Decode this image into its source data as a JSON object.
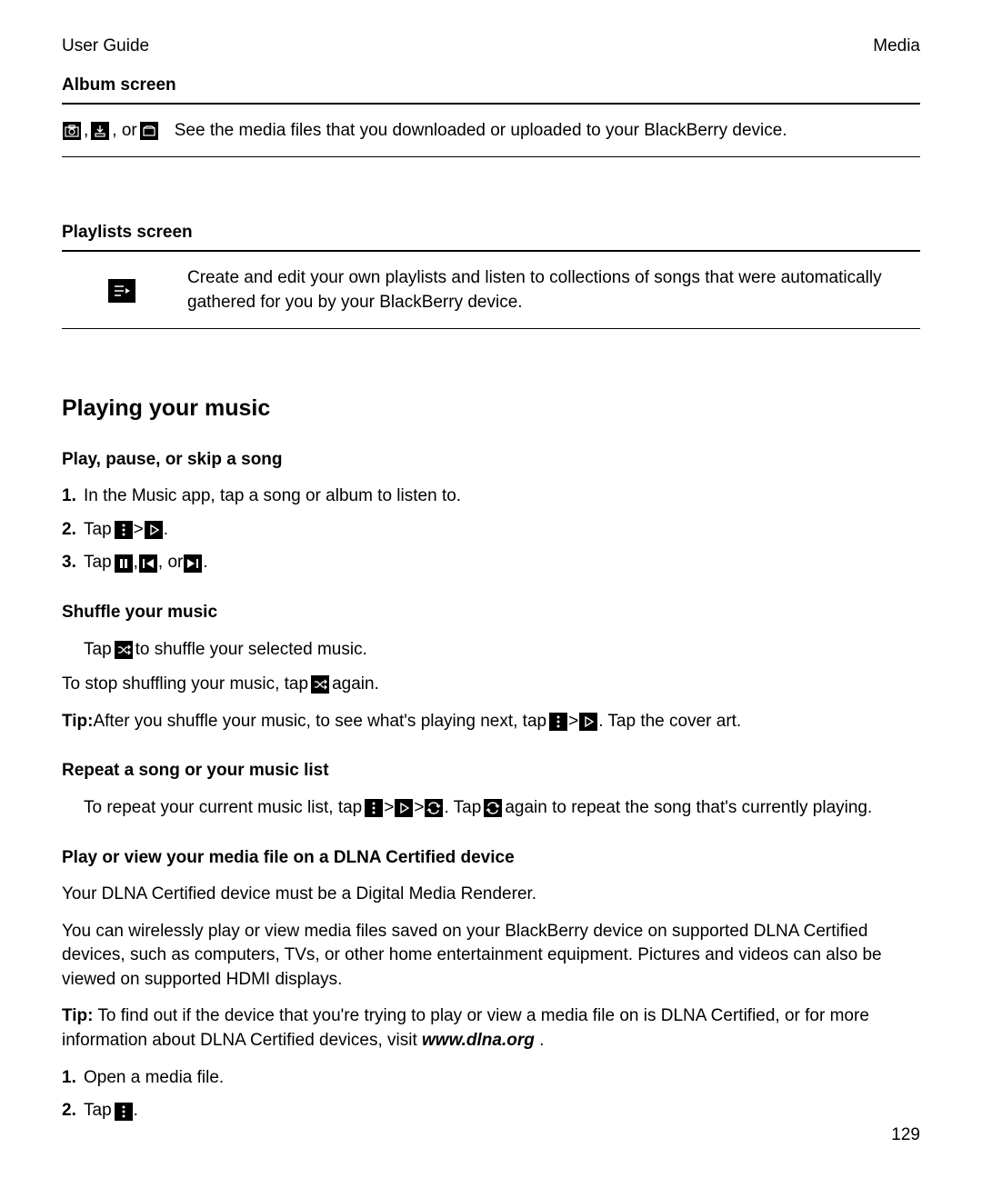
{
  "header": {
    "left": "User Guide",
    "right": "Media"
  },
  "album": {
    "title": "Album screen",
    "or": ", or ",
    "comma": ", ",
    "desc": "See the media files that you downloaded or uploaded to your BlackBerry device."
  },
  "playlists": {
    "title": "Playlists screen",
    "desc": "Create and edit your own playlists and listen to collections of songs that were automatically gathered for you by your BlackBerry device."
  },
  "h2": "Playing your music",
  "playpause": {
    "title": "Play, pause, or skip a song",
    "s1": "In the Music app, tap a song or album to listen to.",
    "s2a": "Tap ",
    "gt": " > ",
    "period": ".",
    "s3a": "Tap ",
    "comma": ", ",
    "or": ", or "
  },
  "shuffle": {
    "title": "Shuffle your music",
    "l1a": "Tap ",
    "l1b": " to shuffle your selected music.",
    "l2a": "To stop shuffling your music, tap ",
    "l2b": " again.",
    "tipLabel": "Tip:",
    "tipA": " After you shuffle your music, to see what's playing next, tap ",
    "gt": " > ",
    "tipB": ". Tap the cover art."
  },
  "repeat": {
    "title": "Repeat a song or your music list",
    "a": "To repeat your current music list, tap ",
    "gt": " > ",
    "b": "> ",
    "c": ". Tap ",
    "d": " again to repeat the song that's currently playing."
  },
  "dlna": {
    "title": "Play or view your media file on a DLNA Certified device",
    "p1": "Your DLNA Certified device must be a Digital Media Renderer.",
    "p2": "You can wirelessly play or view media files saved on your BlackBerry device on supported DLNA Certified devices, such as computers, TVs, or other home entertainment equipment. Pictures and videos can also be viewed on supported HDMI displays.",
    "tipLabel": "Tip:",
    "tipA": " To find out if the device that you're trying to play or view a media file on is DLNA Certified, or for more information about DLNA Certified devices, visit ",
    "tipUrl": "www.dlna.org",
    "period": ".",
    "s1": "Open a media file.",
    "s2a": "Tap "
  },
  "nums": {
    "n1": "1.",
    "n2": "2.",
    "n3": "3."
  },
  "page": "129"
}
